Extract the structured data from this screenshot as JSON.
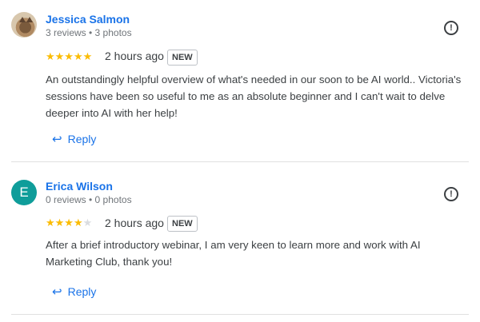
{
  "reviews": [
    {
      "name": "Jessica Salmon",
      "meta": "3 reviews • 3 photos",
      "rating": 5,
      "time": "2 hours ago",
      "badge": "NEW",
      "text": "An outstandingly helpful overview of what's needed in our soon to be AI world.. Victoria's sessions have been so useful to me as an absolute beginner and I can't wait to delve deeper into AI with her help!",
      "reply_label": "Reply",
      "avatar": "photo"
    },
    {
      "name": "Erica Wilson",
      "meta": "0 reviews • 0 photos",
      "rating": 4,
      "time": "2 hours ago",
      "badge": "NEW",
      "text": "After a brief introductory webinar, I am very keen to learn more and work with AI Marketing Club, thank you!",
      "reply_label": "Reply",
      "avatar": "letter",
      "avatar_letter": "E",
      "avatar_color": "#0f9d9a"
    }
  ],
  "icons": {
    "flag": "flag-report-icon",
    "reply": "reply-arrow-icon",
    "star": "star-icon"
  },
  "colors": {
    "link": "#1a73e8",
    "star": "#fbbc04",
    "star_empty": "#dadce0"
  }
}
